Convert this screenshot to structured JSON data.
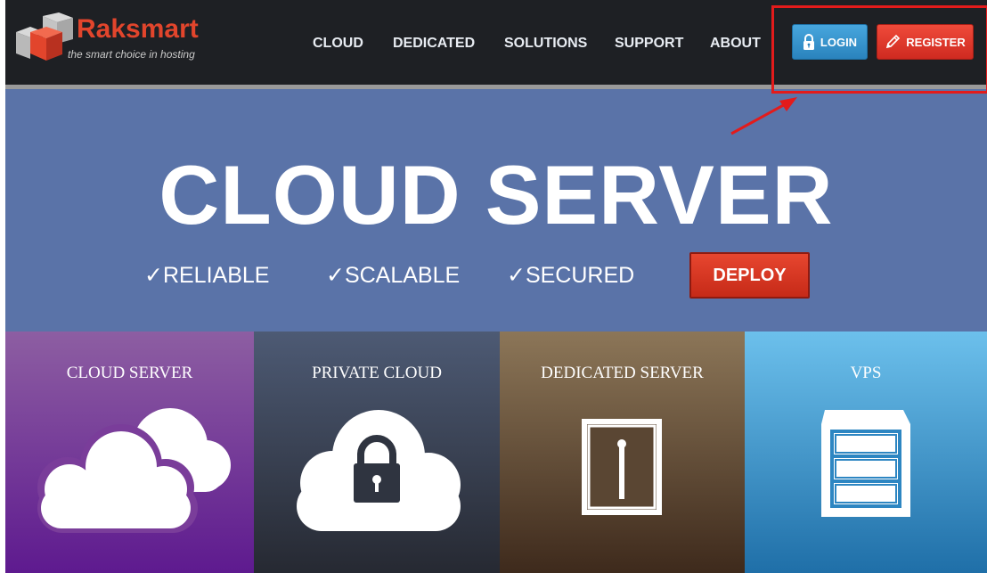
{
  "header": {
    "logo": {
      "name": "Raksmart",
      "tagline": "the smart choice in hosting"
    },
    "nav": [
      "CLOUD",
      "DEDICATED",
      "SOLUTIONS",
      "SUPPORT",
      "ABOUT"
    ],
    "login_label": "LOGIN",
    "register_label": "REGISTER"
  },
  "hero": {
    "title": "CLOUD SERVER",
    "features": [
      "RELIABLE",
      "SCALABLE",
      "SECURED"
    ],
    "check_glyph": "✓",
    "deploy_label": "DEPLOY"
  },
  "tiles": [
    {
      "label": "CLOUD SERVER",
      "icon": "clouds-icon"
    },
    {
      "label": "PRIVATE CLOUD",
      "icon": "cloud-lock-icon"
    },
    {
      "label": "DEDICATED SERVER",
      "icon": "dedicated-server-icon"
    },
    {
      "label": "VPS",
      "icon": "vps-server-icon"
    }
  ],
  "colors": {
    "header_bg": "#1e2024",
    "hero_bg": "#5a73a8",
    "accent_red": "#e2452c",
    "login_blue": "#2a83bd",
    "annotation_red": "#e31b1b"
  }
}
